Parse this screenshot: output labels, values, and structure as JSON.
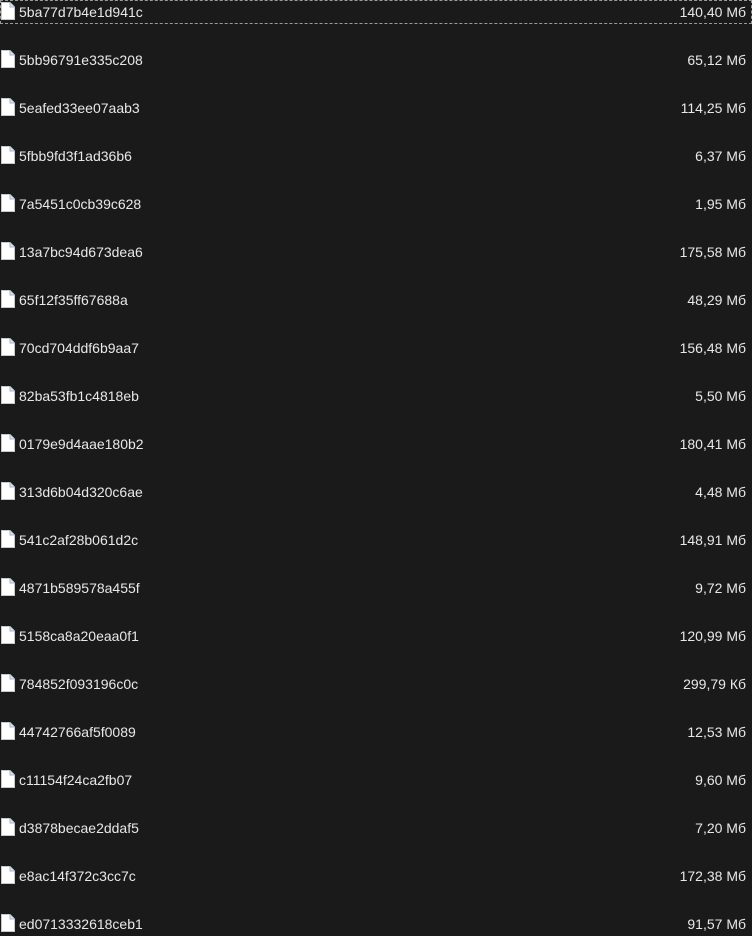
{
  "file_list": {
    "rows": [
      {
        "name": "5ba77d7b4e1d941c",
        "size": "140,40 Мб",
        "focused": true
      },
      {
        "name": "5bb96791e335c208",
        "size": "65,12 Мб"
      },
      {
        "name": "5eafed33ee07aab3",
        "size": "114,25 Мб"
      },
      {
        "name": "5fbb9fd3f1ad36b6",
        "size": "6,37 Мб"
      },
      {
        "name": "7a5451c0cb39c628",
        "size": "1,95 Мб"
      },
      {
        "name": "13a7bc94d673dea6",
        "size": "175,58 Мб"
      },
      {
        "name": "65f12f35ff67688a",
        "size": "48,29 Мб"
      },
      {
        "name": "70cd704ddf6b9aa7",
        "size": "156,48 Мб"
      },
      {
        "name": "82ba53fb1c4818eb",
        "size": "5,50 Мб"
      },
      {
        "name": "0179e9d4aae180b2",
        "size": "180,41 Мб"
      },
      {
        "name": "313d6b04d320c6ae",
        "size": "4,48 Мб"
      },
      {
        "name": "541c2af28b061d2c",
        "size": "148,91 Мб"
      },
      {
        "name": "4871b589578a455f",
        "size": "9,72 Мб"
      },
      {
        "name": "5158ca8a20eaa0f1",
        "size": "120,99 Мб"
      },
      {
        "name": "784852f093196c0c",
        "size": "299,79 Кб"
      },
      {
        "name": "44742766af5f0089",
        "size": "12,53 Мб"
      },
      {
        "name": "c11154f24ca2fb07",
        "size": "9,60 Мб"
      },
      {
        "name": "d3878becae2ddaf5",
        "size": "7,20 Мб"
      },
      {
        "name": "e8ac14f372c3cc7c",
        "size": "172,38 Мб"
      },
      {
        "name": "ed0713332618ceb1",
        "size": "91,57 Мб"
      }
    ],
    "icon": "file-icon",
    "colors": {
      "background": "#1a1a1a",
      "text": "#e8e8e8",
      "icon_fill": "#ffffff",
      "icon_fold": "#9ab4d8"
    }
  }
}
